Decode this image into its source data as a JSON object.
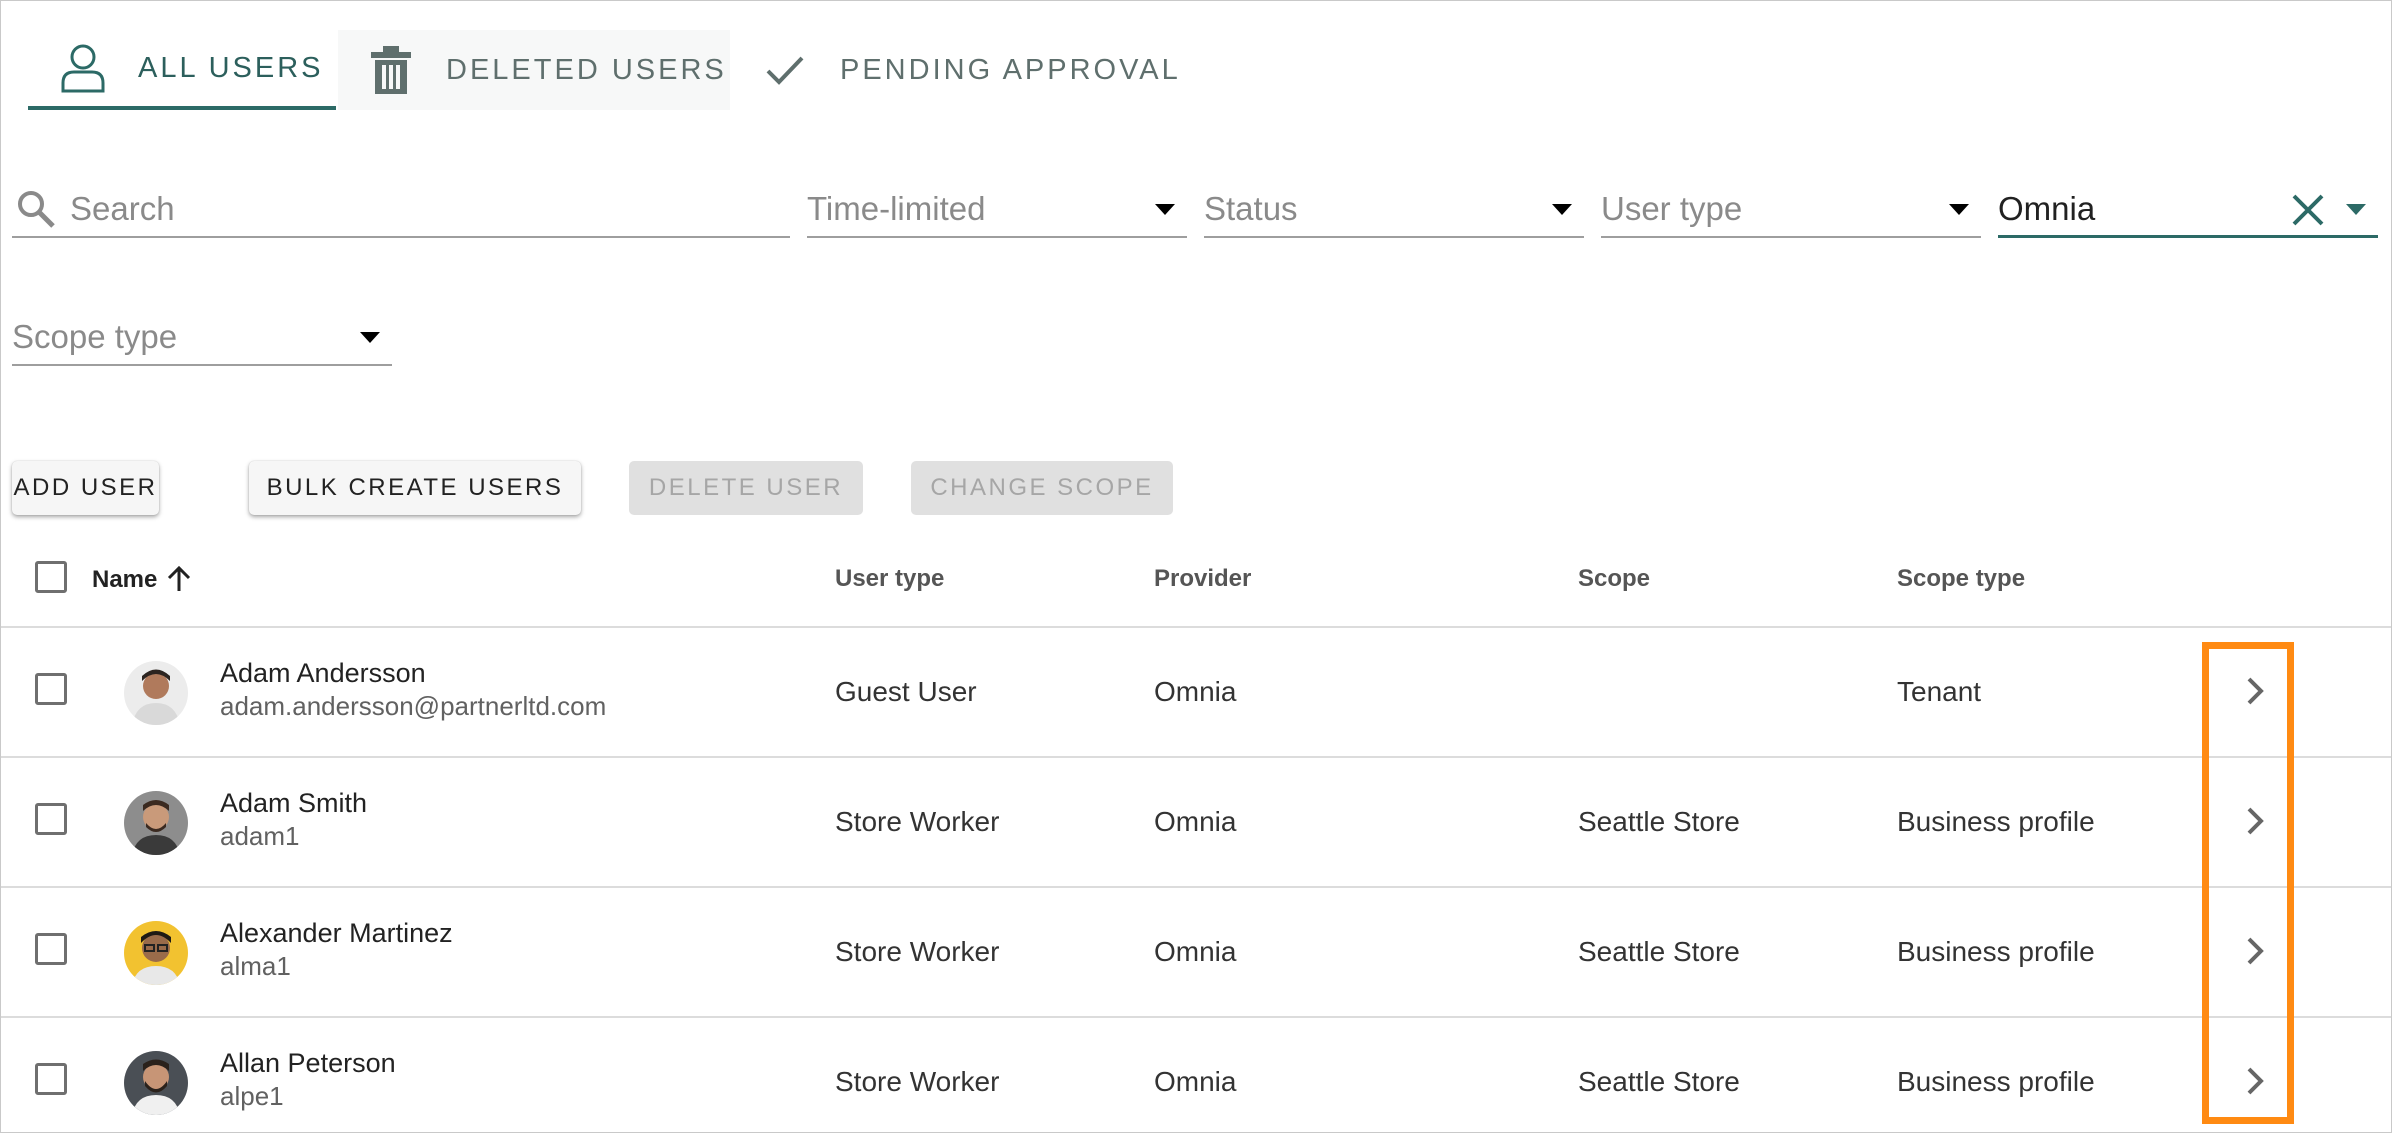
{
  "tabs": [
    {
      "label": "ALL USERS",
      "icon": "user-icon",
      "active": true
    },
    {
      "label": "DELETED USERS",
      "icon": "trash-icon",
      "active": false
    },
    {
      "label": "PENDING APPROVAL",
      "icon": "check-icon",
      "active": false
    }
  ],
  "filters": {
    "search_placeholder": "Search",
    "time_limited": "Time-limited",
    "status": "Status",
    "user_type": "User type",
    "provider_value": "Omnia",
    "scope_type": "Scope type"
  },
  "actions": {
    "add_user": "ADD USER",
    "bulk_create": "BULK CREATE USERS",
    "delete_user": "DELETE USER",
    "change_scope": "CHANGE SCOPE"
  },
  "table": {
    "columns": {
      "name": "Name",
      "user_type": "User type",
      "provider": "Provider",
      "scope": "Scope",
      "scope_type": "Scope type"
    },
    "sort_icon": "arrow-up-icon",
    "rows": [
      {
        "name": "Adam Andersson",
        "id": "adam.andersson@partnerltd.com",
        "user_type": "Guest User",
        "provider": "Omnia",
        "scope": "",
        "scope_type": "Tenant"
      },
      {
        "name": "Adam Smith",
        "id": "adam1",
        "user_type": "Store Worker",
        "provider": "Omnia",
        "scope": "Seattle Store",
        "scope_type": "Business profile"
      },
      {
        "name": "Alexander Martinez",
        "id": "alma1",
        "user_type": "Store Worker",
        "provider": "Omnia",
        "scope": "Seattle Store",
        "scope_type": "Business profile"
      },
      {
        "name": "Allan Peterson",
        "id": "alpe1",
        "user_type": "Store Worker",
        "provider": "Omnia",
        "scope": "Seattle Store",
        "scope_type": "Business profile"
      }
    ]
  },
  "colors": {
    "accent": "#2c6a66",
    "highlight": "#ff8a12",
    "disabled_bg": "#e0e0e0"
  }
}
